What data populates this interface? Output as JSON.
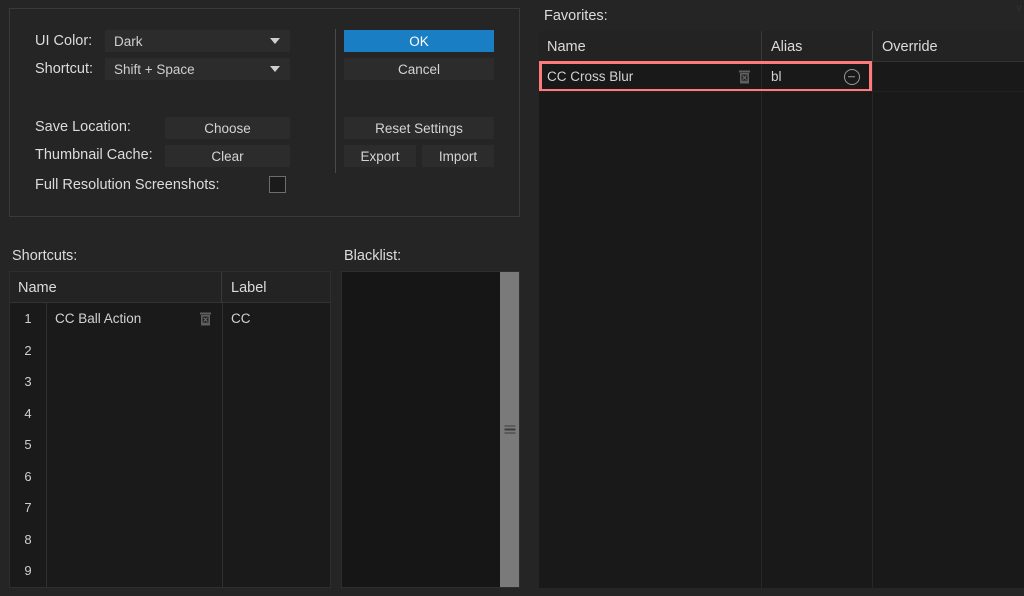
{
  "settings": {
    "ui_color_label": "UI Color:",
    "ui_color_value": "Dark",
    "shortcut_label": "Shortcut:",
    "shortcut_value": "Shift + Space",
    "save_location_label": "Save Location:",
    "save_location_button": "Choose",
    "thumbnail_cache_label": "Thumbnail Cache:",
    "thumbnail_cache_button": "Clear",
    "full_res_label": "Full Resolution Screenshots:",
    "full_res_checked": false
  },
  "actions": {
    "ok": "OK",
    "cancel": "Cancel",
    "reset": "Reset Settings",
    "export": "Export",
    "import": "Import"
  },
  "shortcuts": {
    "caption": "Shortcuts:",
    "columns": [
      "Name",
      "Label"
    ],
    "rows": [
      {
        "num": "1",
        "name": "CC Ball Action",
        "label": "CC",
        "delete_icon": "trash-icon"
      },
      {
        "num": "2",
        "name": "",
        "label": "",
        "delete_icon": ""
      },
      {
        "num": "3",
        "name": "",
        "label": "",
        "delete_icon": ""
      },
      {
        "num": "4",
        "name": "",
        "label": "",
        "delete_icon": ""
      },
      {
        "num": "5",
        "name": "",
        "label": "",
        "delete_icon": ""
      },
      {
        "num": "6",
        "name": "",
        "label": "",
        "delete_icon": ""
      },
      {
        "num": "7",
        "name": "",
        "label": "",
        "delete_icon": ""
      },
      {
        "num": "8",
        "name": "",
        "label": "",
        "delete_icon": ""
      },
      {
        "num": "9",
        "name": "",
        "label": "",
        "delete_icon": ""
      }
    ]
  },
  "blacklist": {
    "caption": "Blacklist:",
    "items": [],
    "scrollbar": "vertical-scrollbar"
  },
  "favorites": {
    "caption": "Favorites:",
    "columns": [
      "Name",
      "Alias",
      "Override"
    ],
    "rows": [
      {
        "name": "CC Cross Blur",
        "alias": "bl",
        "override": "",
        "selected": true,
        "delete_icon": "trash-icon",
        "remove_icon": "minus-circle-icon"
      }
    ]
  },
  "corner_glyph": "v",
  "colors": {
    "app_background": "#252525",
    "panel_background": "#191919",
    "accent_primary": "#1a7ec4",
    "selection_outline": "#ff7b7b",
    "scrollbar_thumb": "#7a7a7a",
    "text_primary": "#dcdcdc"
  }
}
